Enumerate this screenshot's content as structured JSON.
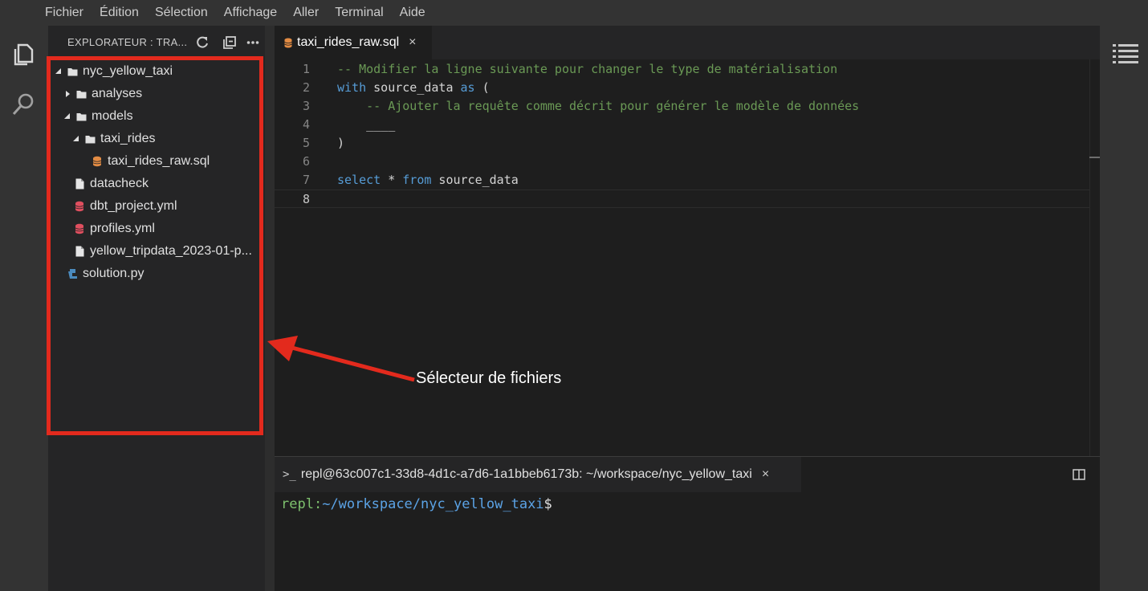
{
  "menu": [
    "Fichier",
    "Édition",
    "Sélection",
    "Affichage",
    "Aller",
    "Terminal",
    "Aide"
  ],
  "activity_bar": {
    "icons": [
      "files-icon",
      "search-icon"
    ]
  },
  "explorer": {
    "title": "EXPLORATEUR : TRA...",
    "header_icons": [
      "refresh-icon",
      "collapse-all-icon",
      "more-icon"
    ],
    "tree": [
      {
        "label": "nyc_yellow_taxi",
        "type": "folder",
        "expanded": true,
        "depth": 0
      },
      {
        "label": "analyses",
        "type": "folder",
        "expanded": false,
        "depth": 1
      },
      {
        "label": "models",
        "type": "folder",
        "expanded": true,
        "depth": 1
      },
      {
        "label": "taxi_rides",
        "type": "folder",
        "expanded": true,
        "depth": 2
      },
      {
        "label": "taxi_rides_raw.sql",
        "type": "sql",
        "depth": 3
      },
      {
        "label": "datacheck",
        "type": "file",
        "depth": 1
      },
      {
        "label": "dbt_project.yml",
        "type": "yml",
        "depth": 1
      },
      {
        "label": "profiles.yml",
        "type": "yml",
        "depth": 1
      },
      {
        "label": "yellow_tripdata_2023-01-p...",
        "type": "file",
        "depth": 1
      },
      {
        "label": "solution.py",
        "type": "py",
        "depth": 0
      }
    ]
  },
  "editor": {
    "tab": {
      "label": "taxi_rides_raw.sql",
      "close": "×"
    },
    "lines": [
      {
        "no": "1",
        "tokens": [
          [
            "c-comment",
            "-- Modifier la ligne suivante pour changer le type de matérialisation"
          ]
        ]
      },
      {
        "no": "2",
        "tokens": [
          [
            "c-kw",
            "with"
          ],
          [
            "c-id",
            " source_data "
          ],
          [
            "c-kw",
            "as"
          ],
          [
            "c-op",
            " ("
          ]
        ]
      },
      {
        "no": "3",
        "tokens": [
          [
            "c-comment",
            "    -- Ajouter la requête comme décrit pour générer le modèle de données"
          ]
        ]
      },
      {
        "no": "4",
        "tokens": [
          [
            "c-id",
            "    ____"
          ]
        ]
      },
      {
        "no": "5",
        "tokens": [
          [
            "c-op",
            ")"
          ]
        ]
      },
      {
        "no": "6",
        "tokens": []
      },
      {
        "no": "7",
        "tokens": [
          [
            "c-kw",
            "select"
          ],
          [
            "c-op",
            " * "
          ],
          [
            "c-kw",
            "from"
          ],
          [
            "c-id",
            " source_data"
          ]
        ]
      },
      {
        "no": "8",
        "tokens": [],
        "current": true
      }
    ]
  },
  "terminal": {
    "tab_title": "repl@63c007c1-33d8-4d1c-a7d6-1a1bbeb6173b: ~/workspace/nyc_yellow_taxi",
    "prompt_icon": ">_",
    "close": "×",
    "prompt_user": "repl",
    "prompt_colon": ":",
    "prompt_path": "~/workspace/nyc_yellow_taxi",
    "prompt_symbol": "$"
  },
  "annotation": {
    "label": "Sélecteur de fichiers",
    "color": "#e32a1d"
  },
  "colors": {
    "folder": "#e0e0e0",
    "sql_icon": "#e38c44",
    "yml_icon": "#e04f5f",
    "py_icon": "#4b8bbe"
  }
}
